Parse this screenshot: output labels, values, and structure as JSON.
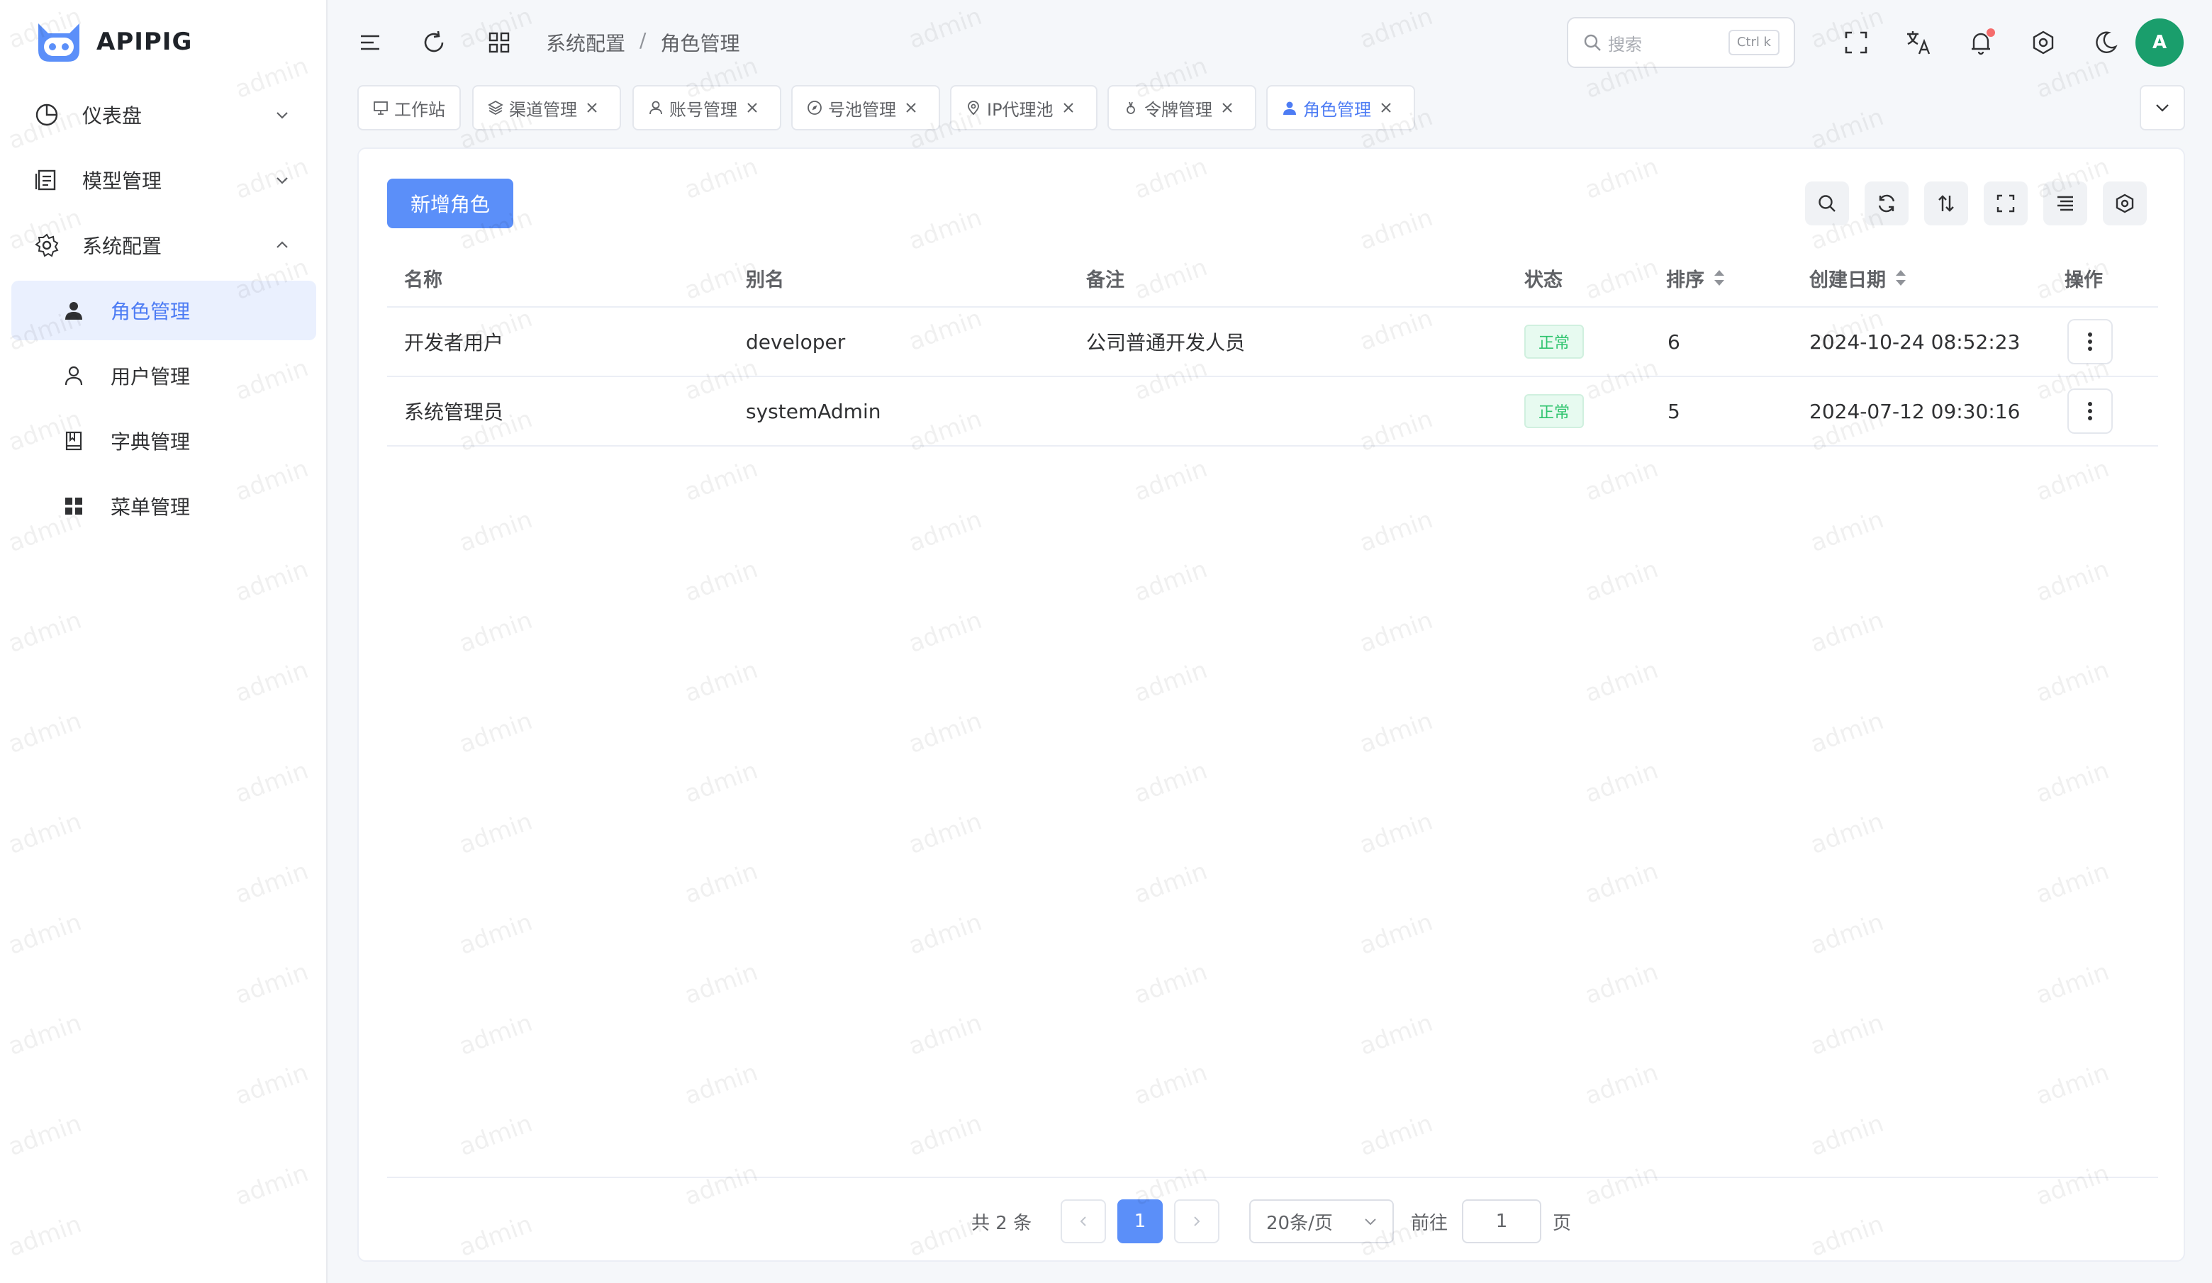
{
  "app": {
    "name": "APIPIG"
  },
  "sidebar": {
    "items": [
      {
        "label": "仪表盘",
        "icon": "pie-chart-icon",
        "expanded": false
      },
      {
        "label": "模型管理",
        "icon": "document-icon",
        "expanded": false
      },
      {
        "label": "系统配置",
        "icon": "gear-icon",
        "expanded": true,
        "children": [
          {
            "label": "角色管理",
            "icon": "user-filled-icon",
            "active": true
          },
          {
            "label": "用户管理",
            "icon": "user-outline-icon"
          },
          {
            "label": "字典管理",
            "icon": "book-icon"
          },
          {
            "label": "菜单管理",
            "icon": "grid-icon"
          }
        ]
      }
    ]
  },
  "header": {
    "breadcrumb": [
      "系统配置",
      "角色管理"
    ],
    "breadcrumb_sep": "/",
    "search_placeholder": "搜索",
    "search_shortcut": "Ctrl k",
    "avatar_letter": "A"
  },
  "tabs": [
    {
      "label": "工作站",
      "icon": "monitor-icon",
      "closable": false
    },
    {
      "label": "渠道管理",
      "icon": "layers-icon",
      "closable": true
    },
    {
      "label": "账号管理",
      "icon": "user-outline-icon",
      "closable": true
    },
    {
      "label": "号池管理",
      "icon": "compass-icon",
      "closable": true
    },
    {
      "label": "IP代理池",
      "icon": "location-icon",
      "closable": true
    },
    {
      "label": "令牌管理",
      "icon": "token-icon",
      "closable": true
    },
    {
      "label": "角色管理",
      "icon": "user-filled-icon",
      "closable": true,
      "active": true
    }
  ],
  "toolbar": {
    "add_label": "新增角色"
  },
  "table": {
    "columns": [
      "名称",
      "别名",
      "备注",
      "状态",
      "排序",
      "创建日期",
      "操作"
    ],
    "rows": [
      {
        "name": "开发者用户",
        "alias": "developer",
        "remark": "公司普通开发人员",
        "status": "正常",
        "sort": "6",
        "created": "2024-10-24 08:52:23"
      },
      {
        "name": "系统管理员",
        "alias": "systemAdmin",
        "remark": "",
        "status": "正常",
        "sort": "5",
        "created": "2024-07-12 09:30:16"
      }
    ]
  },
  "pagination": {
    "total_label": "共 2 条",
    "current_page": "1",
    "page_size": "20条/页",
    "goto_label": "前往",
    "goto_value": "1",
    "page_unit": "页"
  },
  "watermark": "admin",
  "colors": {
    "primary": "#5b8ff9",
    "success": "#2fc46e",
    "avatar": "#1a9e6c",
    "notification": "#f56c6c"
  }
}
